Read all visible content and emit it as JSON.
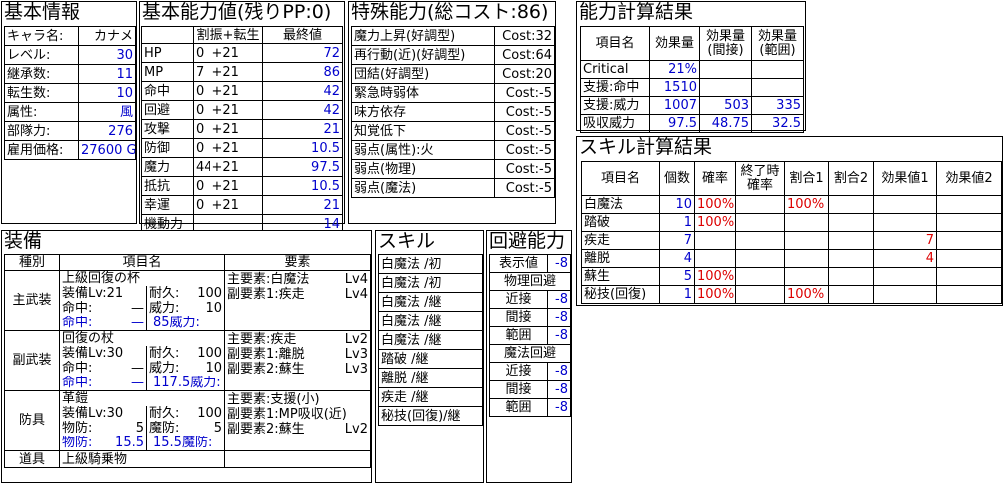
{
  "basic_info": {
    "title": "基本情報",
    "rows": [
      {
        "label": "キャラ名:",
        "value": "カナメ"
      },
      {
        "label": "レベル:",
        "value": "30"
      },
      {
        "label": "継承数:",
        "value": "11"
      },
      {
        "label": "転生数:",
        "value": "10"
      },
      {
        "label": "属性:",
        "value": "風"
      },
      {
        "label": "部隊力:",
        "value": "276"
      },
      {
        "label": "雇用価格:",
        "value": "27600 G"
      }
    ]
  },
  "base_stats": {
    "title": "基本能力値(残りPP:0)",
    "header": [
      "",
      "割振+転生",
      "最終値"
    ],
    "rows": [
      {
        "label": "HP",
        "alloc": "0",
        "bonus": "+21",
        "final": "72"
      },
      {
        "label": "MP",
        "alloc": "7",
        "bonus": "+21",
        "final": "86"
      },
      {
        "label": "命中",
        "alloc": "0",
        "bonus": "+21",
        "final": "42"
      },
      {
        "label": "回避",
        "alloc": "0",
        "bonus": "+21",
        "final": "42"
      },
      {
        "label": "攻撃",
        "alloc": "0",
        "bonus": "+21",
        "final": "21"
      },
      {
        "label": "防御",
        "alloc": "0",
        "bonus": "+21",
        "final": "10.5"
      },
      {
        "label": "魔力",
        "alloc": "44",
        "bonus": "+21",
        "final": "97.5"
      },
      {
        "label": "抵抗",
        "alloc": "0",
        "bonus": "+21",
        "final": "10.5"
      },
      {
        "label": "幸運",
        "alloc": "0",
        "bonus": "+21",
        "final": "21"
      },
      {
        "label": "機動力",
        "alloc": "",
        "bonus": "",
        "final": "14"
      }
    ]
  },
  "special_abilities": {
    "title": "特殊能力(総コスト:86)",
    "rows": [
      {
        "name": "魔力上昇(好調型)",
        "cost": "Cost:32"
      },
      {
        "name": "再行動(近)(好調型)",
        "cost": "Cost:64"
      },
      {
        "name": "団結(好調型)",
        "cost": "Cost:20"
      },
      {
        "name": "緊急時弱体",
        "cost": "Cost:-5"
      },
      {
        "name": "味方依存",
        "cost": "Cost:-5"
      },
      {
        "name": "知覚低下",
        "cost": "Cost:-5"
      },
      {
        "name": "弱点(属性):火",
        "cost": "Cost:-5"
      },
      {
        "name": "弱点(物理)",
        "cost": "Cost:-5"
      },
      {
        "name": "弱点(魔法)",
        "cost": "Cost:-5"
      }
    ]
  },
  "ability_calc": {
    "title": "能力計算結果",
    "header": [
      "項目名",
      "効果量",
      "効果量\n(間接)",
      "効果量\n(範囲)"
    ],
    "rows": [
      {
        "name": "Critical",
        "v1": "21%",
        "v2": "",
        "v3": ""
      },
      {
        "name": "支援:命中",
        "v1": "1510",
        "v2": "",
        "v3": ""
      },
      {
        "name": "支援:威力",
        "v1": "1007",
        "v2": "503",
        "v3": "335"
      },
      {
        "name": "吸収威力",
        "v1": "97.5",
        "v2": "48.75",
        "v3": "32.5"
      }
    ]
  },
  "skill_calc": {
    "title": "スキル計算結果",
    "header": [
      "項目名",
      "個数",
      "確率",
      "終了時\n確率",
      "割合1",
      "割合2",
      "効果値1",
      "効果値2"
    ],
    "rows": [
      {
        "name": "白魔法",
        "count": "10",
        "rate": "100%",
        "end": "",
        "p1": "100%",
        "p2": "",
        "e1": "",
        "e2": ""
      },
      {
        "name": "踏破",
        "count": "1",
        "rate": "100%",
        "end": "",
        "p1": "",
        "p2": "",
        "e1": "",
        "e2": ""
      },
      {
        "name": "疾走",
        "count": "7",
        "rate": "",
        "end": "",
        "p1": "",
        "p2": "",
        "e1": "7",
        "e2": ""
      },
      {
        "name": "離脱",
        "count": "4",
        "rate": "",
        "end": "",
        "p1": "",
        "p2": "",
        "e1": "4",
        "e2": ""
      },
      {
        "name": "蘇生",
        "count": "5",
        "rate": "100%",
        "end": "",
        "p1": "",
        "p2": "",
        "e1": "",
        "e2": ""
      },
      {
        "name": "秘技(回復)",
        "count": "1",
        "rate": "100%",
        "end": "",
        "p1": "100%",
        "p2": "",
        "e1": "",
        "e2": ""
      }
    ]
  },
  "equipment": {
    "title": "装備",
    "header": [
      "種別",
      "項目名",
      "要素"
    ],
    "items": [
      {
        "type": "主武装",
        "name": "上級回復の杯",
        "lv": "装備Lv:21",
        "dur_label": "耐久:",
        "dur": "100",
        "hit_label": "命中:",
        "hit": "—",
        "pow_label": "威力:",
        "pow": "10",
        "hit2_label": "命中:",
        "hit2": "—",
        "pow2_label": "威力:",
        "pow2": "85",
        "elements": [
          {
            "label": "主要素:白魔法",
            "lv": "Lv4"
          },
          {
            "label": "副要素1:疾走",
            "lv": "Lv4"
          }
        ]
      },
      {
        "type": "副武装",
        "name": "回復の杖",
        "lv": "装備Lv:30",
        "dur_label": "耐久:",
        "dur": "100",
        "hit_label": "命中:",
        "hit": "—",
        "pow_label": "威力:",
        "pow": "10",
        "hit2_label": "命中:",
        "hit2": "—",
        "pow2_label": "威力:",
        "pow2": "117.5",
        "elements": [
          {
            "label": "主要素:疾走",
            "lv": "Lv2"
          },
          {
            "label": "副要素1:離脱",
            "lv": "Lv3"
          },
          {
            "label": "副要素2:蘇生",
            "lv": "Lv3"
          }
        ]
      },
      {
        "type": "防具",
        "name": "革鎧",
        "lv": "装備Lv:30",
        "dur_label": "耐久:",
        "dur": "100",
        "hit_label": "物防:",
        "hit": "5",
        "pow_label": "魔防:",
        "pow": "5",
        "hit2_label": "物防:",
        "hit2": "15.5",
        "pow2_label": "魔防:",
        "pow2": "15.5",
        "elements": [
          {
            "label": "主要素:支援(小)",
            "lv": ""
          },
          {
            "label": "副要素1:MP吸収(近)",
            "lv": ""
          },
          {
            "label": "副要素2:蘇生",
            "lv": "Lv2"
          }
        ]
      }
    ],
    "tool": {
      "type": "道具",
      "name": "上級騎乗物"
    }
  },
  "skills": {
    "title": "スキル",
    "items": [
      "白魔法 /初",
      "白魔法 /初",
      "白魔法 /継",
      "白魔法 /継",
      "白魔法 /継",
      "踏破 /継",
      "離脱 /継",
      "疾走 /継",
      "秘技(回復)/継"
    ]
  },
  "evasion": {
    "title": "回避能力",
    "display_label": "表示値",
    "display_value": "-8",
    "phys_title": "物理回避",
    "phys": [
      {
        "label": "近接",
        "value": "-8"
      },
      {
        "label": "間接",
        "value": "-8"
      },
      {
        "label": "範囲",
        "value": "-8"
      }
    ],
    "magic_title": "魔法回避",
    "magic": [
      {
        "label": "近接",
        "value": "-8"
      },
      {
        "label": "間接",
        "value": "-8"
      },
      {
        "label": "範囲",
        "value": "-8"
      }
    ]
  },
  "colors": {
    "value_blue": "#0000cc",
    "value_red": "#dd0000",
    "border": "#000000"
  }
}
